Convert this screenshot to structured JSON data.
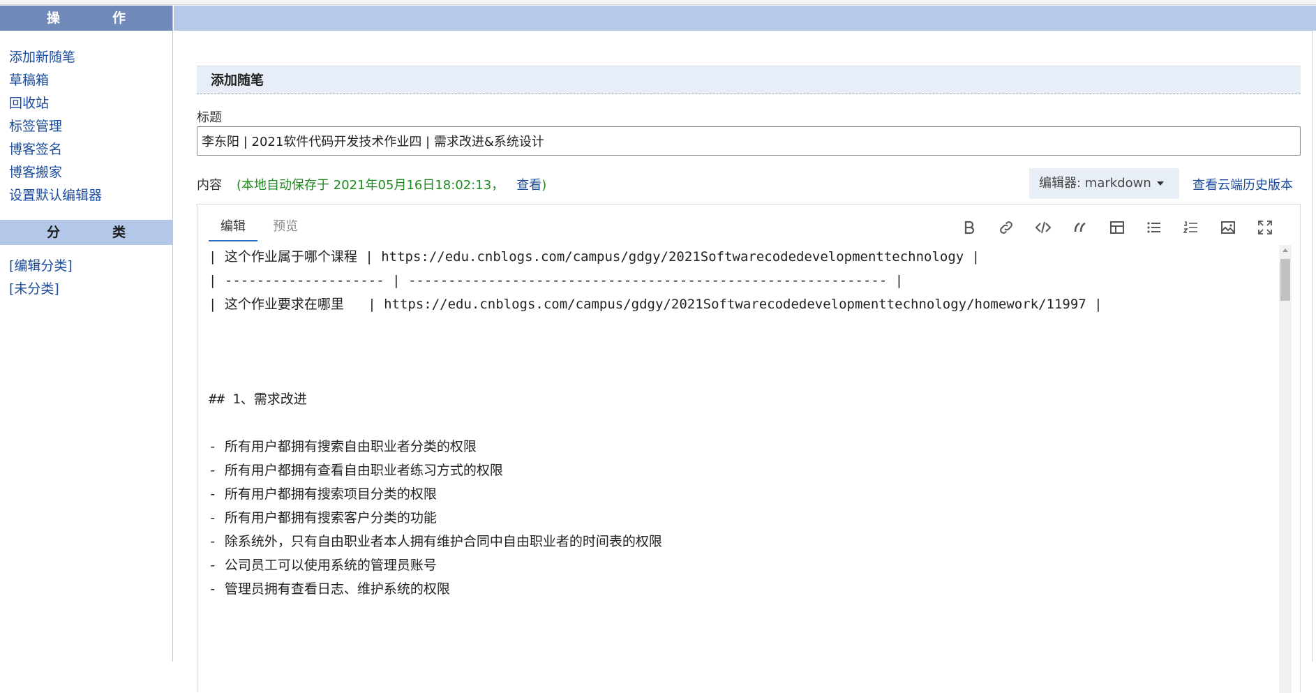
{
  "sidebar": {
    "ops_header": "操　作",
    "ops_items": [
      "添加新随笔",
      "草稿箱",
      "回收站",
      "标签管理",
      "博客签名",
      "博客搬家",
      "设置默认编辑器"
    ],
    "cat_header": "分　类",
    "cat_items": [
      "[编辑分类]",
      "[未分类]"
    ]
  },
  "main": {
    "section_title": "添加随笔",
    "title_label": "标题",
    "title_value": "李东阳 | 2021软件代码开发技术作业四 | 需求改进&系统设计",
    "content_label": "内容",
    "autosave_text": "(本地自动保存于 2021年05月16日18:02:13，",
    "autosave_link": "查看",
    "autosave_close": ")",
    "editor_select": "编辑器: markdown",
    "history_link": "查看云端历史版本"
  },
  "editor": {
    "tabs": [
      "编辑",
      "预览"
    ],
    "active_tab": 0,
    "toolbar_icons": [
      "bold-icon",
      "link-icon",
      "code-icon",
      "quote-icon",
      "table-icon",
      "bulleted-list-icon",
      "numbered-list-icon",
      "image-icon",
      "fullscreen-icon"
    ],
    "lines": [
      "| 这个作业属于哪个课程 | https://edu.cnblogs.com/campus/gdgy/2021Softwarecodedevelopmenttechnology |",
      "| -------------------- | ------------------------------------------------------------ |",
      "| 这个作业要求在哪里   | https://edu.cnblogs.com/campus/gdgy/2021Softwarecodedevelopmenttechnology/homework/11997 |",
      "",
      "",
      "",
      "## 1、需求改进",
      "",
      "- 所有用户都拥有搜索自由职业者分类的权限",
      "- 所有用户都拥有查看自由职业者练习方式的权限",
      "- 所有用户都拥有搜索项目分类的权限",
      "- 所有用户都拥有搜索客户分类的功能",
      "- 除系统外，只有自由职业者本人拥有维护合同中自由职业者的时间表的权限",
      "- 公司员工可以使用系统的管理员账号",
      "- 管理员拥有查看日志、维护系统的权限",
      "",
      "",
      ""
    ]
  },
  "colors": {
    "sidebar_header_dark": "#6f89b8",
    "sidebar_header_light": "#b3c8e8",
    "link": "#1a4a9c",
    "autosave_green": "#1e8a1e"
  }
}
